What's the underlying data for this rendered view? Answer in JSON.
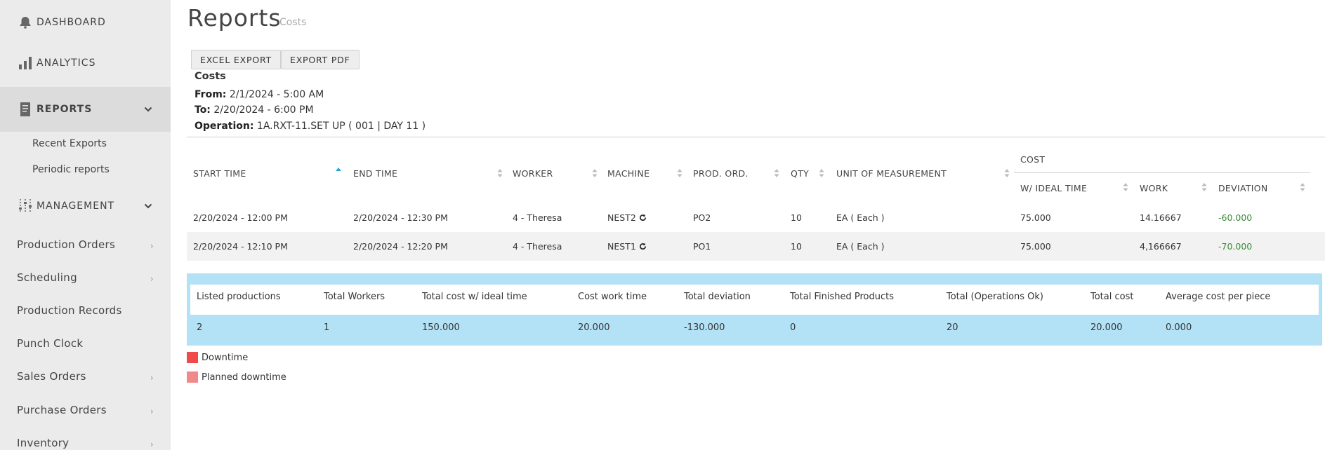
{
  "sidebar": {
    "top_items": [
      {
        "label": "DASHBOARD",
        "icon": "bell-icon"
      },
      {
        "label": "ANALYTICS",
        "icon": "bar-chart-icon"
      },
      {
        "label": "REPORTS",
        "icon": "document-icon"
      }
    ],
    "reports_sub": [
      "Recent Exports",
      "Periodic reports"
    ],
    "management": {
      "label": "MANAGEMENT",
      "icon": "sliders-icon"
    },
    "management_items": [
      "Production Orders",
      "Scheduling",
      "Production Records",
      "Punch Clock",
      "Sales Orders",
      "Purchase Orders",
      "Inventory"
    ]
  },
  "page": {
    "title": "Reports",
    "subtitle": "Costs"
  },
  "buttons": {
    "excel": "EXCEL EXPORT",
    "pdf": "EXPORT PDF"
  },
  "report_info": {
    "heading": "Costs",
    "from_label": "From:",
    "from_value": "2/1/2024 - 5:00 AM",
    "to_label": "To:",
    "to_value": "2/20/2024 - 6:00 PM",
    "op_label": "Operation:",
    "op_value": "1A.RXT-11.SET UP ( 001 | DAY 11 )"
  },
  "table": {
    "headers": {
      "start": "START TIME",
      "end": "END TIME",
      "worker": "WORKER",
      "machine": "MACHINE",
      "prod": "PROD. ORD.",
      "qty": "QTY",
      "uom": "UNIT OF MEASUREMENT",
      "cost": "COST",
      "ideal": "W/ IDEAL TIME",
      "work": "WORK",
      "deviation": "DEVIATION"
    },
    "rows": [
      {
        "start": "2/20/2024 - 12:00 PM",
        "end": "2/20/2024 - 12:30 PM",
        "worker": "4 - Theresa",
        "machine": "NEST2",
        "prod": "PO2",
        "qty": "10",
        "uom": "EA ( Each )",
        "ideal": "75.000",
        "work": "14.16667",
        "deviation": "-60.000"
      },
      {
        "start": "2/20/2024 - 12:10 PM",
        "end": "2/20/2024 - 12:20 PM",
        "worker": "4 - Theresa",
        "machine": "NEST1",
        "prod": "PO1",
        "qty": "10",
        "uom": "EA ( Each )",
        "ideal": "75.000",
        "work": "4,166667",
        "deviation": "-70.000"
      }
    ]
  },
  "summary": {
    "headers": [
      "Listed productions",
      "Total Workers",
      "Total cost w/ ideal time",
      "Cost work time",
      "Total deviation",
      "Total Finished Products",
      "Total (Operations Ok)",
      "Total cost",
      "Average cost per piece"
    ],
    "values": [
      "2",
      "1",
      "150.000",
      "20.000",
      "-130.000",
      "0",
      "20",
      "20.000",
      "0.000"
    ]
  },
  "legend": [
    {
      "label": "Downtime",
      "color": "#f04a4a"
    },
    {
      "label": "Planned downtime",
      "color": "#f08a8a"
    }
  ],
  "colors": {
    "accent": "#29a3d6",
    "negative": "#3a8a3a",
    "summary_bg": "#b3e2f6"
  }
}
